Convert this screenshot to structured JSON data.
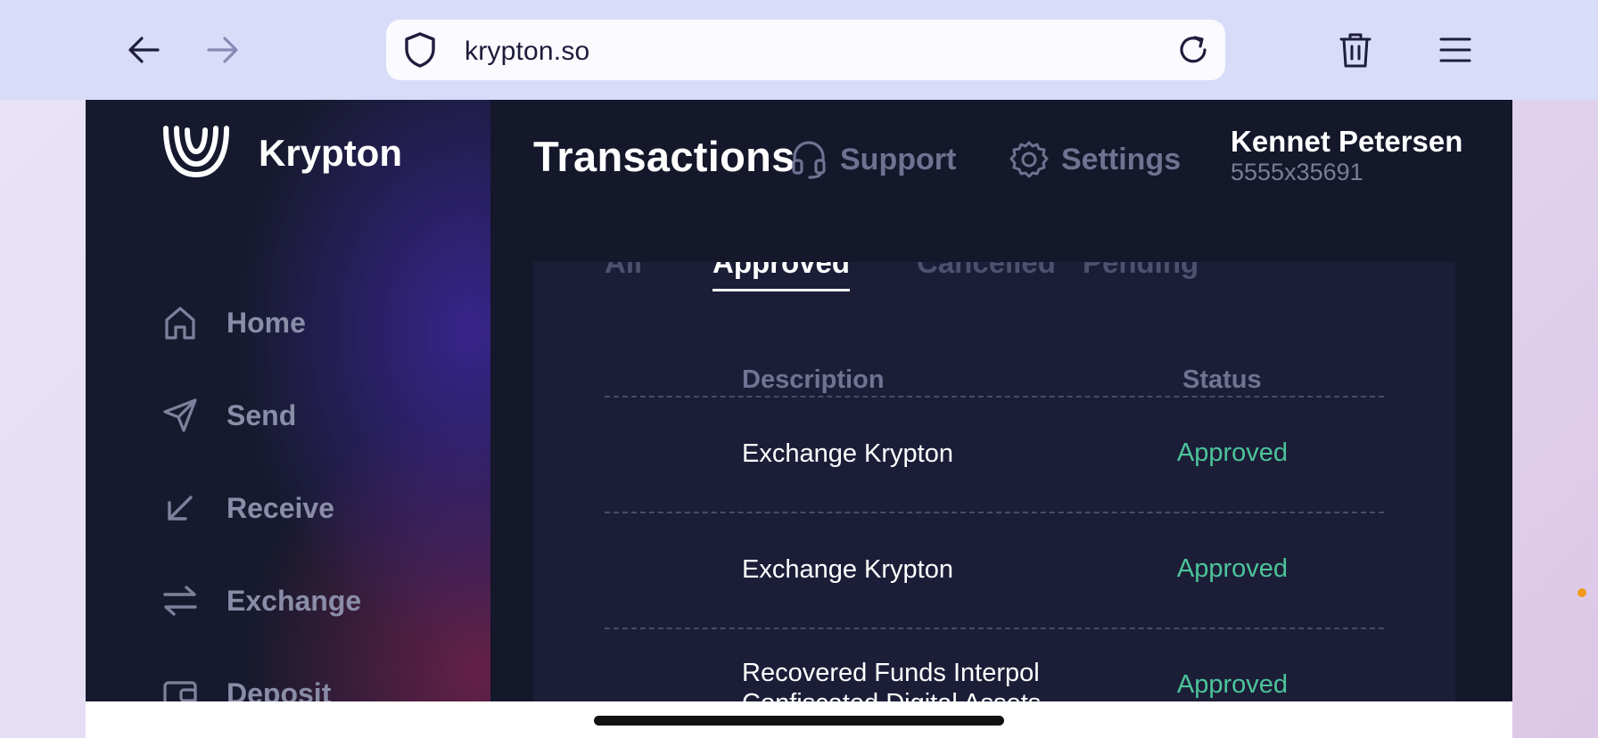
{
  "browser": {
    "url": "krypton.so"
  },
  "app": {
    "brand": "Krypton",
    "sidebar": {
      "items": [
        {
          "label": "Home",
          "icon": "home-icon"
        },
        {
          "label": "Send",
          "icon": "send-icon"
        },
        {
          "label": "Receive",
          "icon": "receive-arrow-icon"
        },
        {
          "label": "Exchange",
          "icon": "exchange-arrows-icon"
        },
        {
          "label": "Deposit",
          "icon": "wallet-icon"
        }
      ]
    },
    "header": {
      "title": "Transactions",
      "support_label": "Support",
      "settings_label": "Settings",
      "user_name": "Kennet Petersen",
      "user_id": "5555x35691"
    },
    "tabs": [
      {
        "label": "All",
        "active": false
      },
      {
        "label": "Approved",
        "active": true
      },
      {
        "label": "Cancelled",
        "active": false
      },
      {
        "label": "Pending",
        "active": false
      }
    ],
    "table": {
      "columns": {
        "description": "Description",
        "status": "Status"
      },
      "rows": [
        {
          "description": "Exchange Krypton",
          "status": "Approved"
        },
        {
          "description": "Exchange Krypton",
          "status": "Approved"
        },
        {
          "description": "Recovered Funds Interpol Confiscated Digital Assets",
          "status": "Approved"
        }
      ]
    }
  },
  "colors": {
    "accent_status": "#4cc49a",
    "app_background": "#15172a",
    "panel_background": "#1c1e38"
  }
}
